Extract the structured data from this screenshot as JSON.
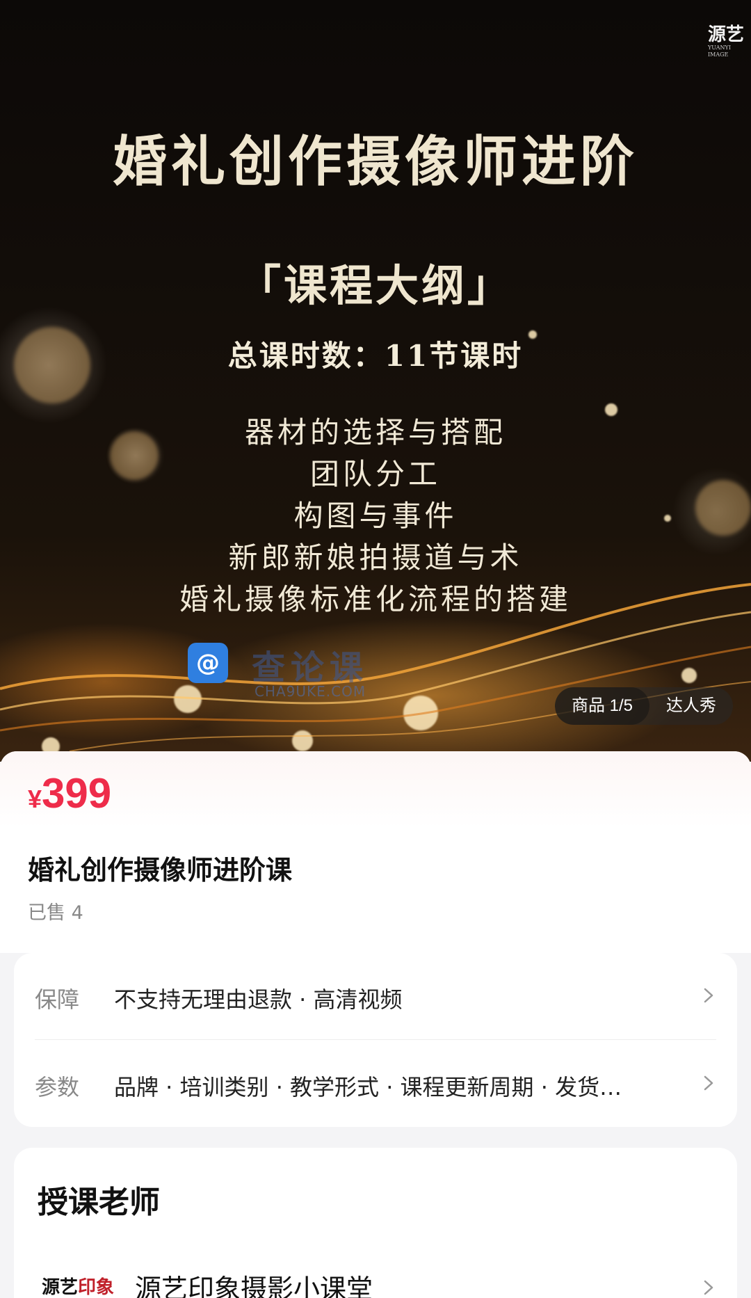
{
  "hero": {
    "brand_mark": "源艺",
    "title": "婚礼创作摄像师进阶",
    "subtitle": "「课程大纲」",
    "total_hours": "总课时数：11节课时",
    "outline": [
      "器材的选择与搭配",
      "团队分工",
      "构图与事件",
      "新郎新娘拍摄道与术",
      "婚礼摄像标准化流程的搭建"
    ],
    "watermark_cn": "查论课",
    "watermark_en": "CHA9UKE.COM",
    "tabs": {
      "product": "商品 1/5",
      "show": "达人秀"
    }
  },
  "product": {
    "currency": "¥",
    "price": "399",
    "title": "婚礼创作摄像师进阶课",
    "sold": "已售 4",
    "price_color": "#ee2c4a"
  },
  "info": {
    "guarantee": {
      "label": "保障",
      "value": "不支持无理由退款 · 高清视频"
    },
    "params": {
      "label": "参数",
      "value": "品牌 · 培训类别 · 教学形式 · 课程更新周期 · 发货…"
    }
  },
  "teacher": {
    "heading": "授课老师",
    "logo_text": "源艺",
    "logo_accent": "印象",
    "name": "源艺印象摄影小课堂"
  }
}
